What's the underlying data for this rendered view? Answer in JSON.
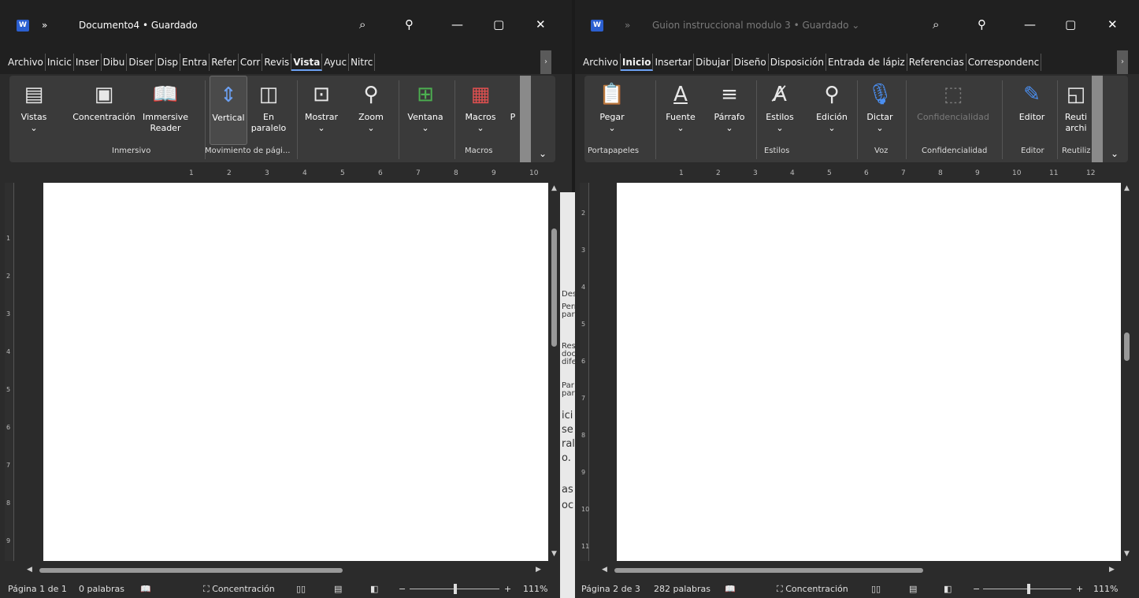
{
  "left_window": {
    "app_icon_letter": "W",
    "overflow": "»",
    "title": "Documento4 • Guardado",
    "window_controls": [
      "⌕",
      "⚲",
      "—",
      "▢",
      "✕"
    ],
    "tabs": [
      "Archivo",
      "Inicio",
      "Insertar",
      "Dibujar",
      "Diseño",
      "Disposición",
      "Entrada",
      "Referencias",
      "Correspondencia",
      "Revisar",
      "Vista",
      "Ayuda",
      "Nitro"
    ],
    "tabs_visible": [
      "Archivo",
      "Inicic",
      "Inser",
      "Dibu",
      "Diser",
      "Disp",
      "Entra",
      "Refer",
      "Corr",
      "Revis",
      "Vista",
      "Ayuc",
      "Nitrc"
    ],
    "active_tab": "Vista",
    "ribbon": {
      "vistas": "Vistas",
      "concentracion": "Concentración",
      "immersive_1": "Immersive",
      "immersive_2": "Reader",
      "vertical": "Vertical",
      "paralelo_1": "En",
      "paralelo_2": "paralelo",
      "mostrar": "Mostrar",
      "zoom": "Zoom",
      "ventana": "Ventana",
      "macros": "Macros",
      "overflow_letter": "P",
      "groups": [
        "Inmersivo",
        "Movimiento de pági...",
        "Macros"
      ]
    },
    "ruler_numbers": [
      "1",
      "2",
      "3",
      "4",
      "5",
      "6",
      "7",
      "8",
      "9",
      "10"
    ],
    "vruler_numbers": [
      "1",
      "2",
      "3",
      "4",
      "5",
      "6",
      "7",
      "8",
      "9"
    ],
    "status": {
      "page": "Página 1 de 1",
      "words": "0 palabras",
      "focus": "Concentración",
      "zoom": "111%",
      "zoom_minus": "−",
      "zoom_plus": "+"
    },
    "scroll": {
      "vertical_position": 0.0,
      "horizontal_position": 0.0
    }
  },
  "right_window": {
    "app_icon_letter": "W",
    "overflow": "»",
    "title": "Guion instruccional modulo 3 • Guardado ⌄",
    "window_controls": [
      "⌕",
      "⚲",
      "—",
      "▢",
      "✕"
    ],
    "tabs": [
      "Archivo",
      "Inicio",
      "Insertar",
      "Dibujar",
      "Diseño",
      "Disposición",
      "Entrada de lápiz",
      "Referencias",
      "Correspondencia"
    ],
    "tabs_visible": [
      "Archivo",
      "Inicio",
      "Insertar",
      "Dibujar",
      "Diseño",
      "Disposición",
      "Entrada de lápiz",
      "Referencias",
      "Correspondenc"
    ],
    "active_tab": "Inicio",
    "ribbon": {
      "pegar": "Pegar",
      "fuente": "Fuente",
      "parrafo": "Párrafo",
      "estilos": "Estilos",
      "edicion": "Edición",
      "dictar": "Dictar",
      "confidencialidad": "Confidencialidad",
      "editor": "Editor",
      "reutilizar_1": "Reuti",
      "reutilizar_2": "archi",
      "groups": [
        "Portapapeles",
        "Estilos",
        "Voz",
        "Confidencialidad",
        "Editor",
        "Reutiliz"
      ]
    },
    "ruler_numbers": [
      "1",
      "2",
      "3",
      "4",
      "5",
      "6",
      "7",
      "8",
      "9",
      "10",
      "11",
      "12"
    ],
    "vruler_numbers": [
      "2",
      "3",
      "4",
      "5",
      "6",
      "7",
      "8",
      "9",
      "10",
      "11"
    ],
    "status": {
      "page": "Página 2 de 3",
      "words": "282 palabras",
      "focus": "Concentración",
      "zoom": "111%",
      "zoom_minus": "−",
      "zoom_plus": "+"
    }
  },
  "background_window_fragments": [
    "Des",
    "Perr",
    "par",
    "Res",
    "doc",
    "dife",
    "Par",
    "par",
    "ici",
    "se",
    "ral",
    "o.",
    "as",
    "oc"
  ],
  "colors": {
    "accent": "#6ca0f2",
    "word_blue": "#2b5fd0",
    "chrome": "#202020",
    "ribbon": "#3a3a3a"
  }
}
